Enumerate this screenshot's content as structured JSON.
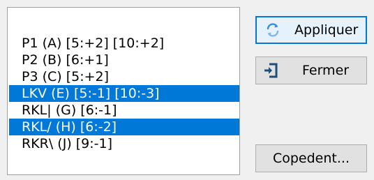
{
  "list": {
    "items": [
      {
        "label": "P1 (A) [5:+2] [10:+2]",
        "selected": false
      },
      {
        "label": "P2 (B) [6:+1]",
        "selected": false
      },
      {
        "label": "P3 (C) [5:+2]",
        "selected": false
      },
      {
        "label": "LKV (E) [5:-1] [10:-3]",
        "selected": true
      },
      {
        "label": "RKL| (G) [6:-1]",
        "selected": false
      },
      {
        "label": "RKL/ (H) [6:-2]",
        "selected": true
      },
      {
        "label": "RKR\\ (J) [9:-1]",
        "selected": false
      }
    ]
  },
  "buttons": {
    "apply": {
      "label": "Appliquer",
      "icon": "refresh-icon"
    },
    "close": {
      "label": "Fermer",
      "icon": "exit-icon"
    },
    "copedent": {
      "label": "Copedent..."
    }
  },
  "colors": {
    "selection": "#0078d7",
    "focus_border": "#0078d7",
    "button_face": "#e1e1e1"
  }
}
